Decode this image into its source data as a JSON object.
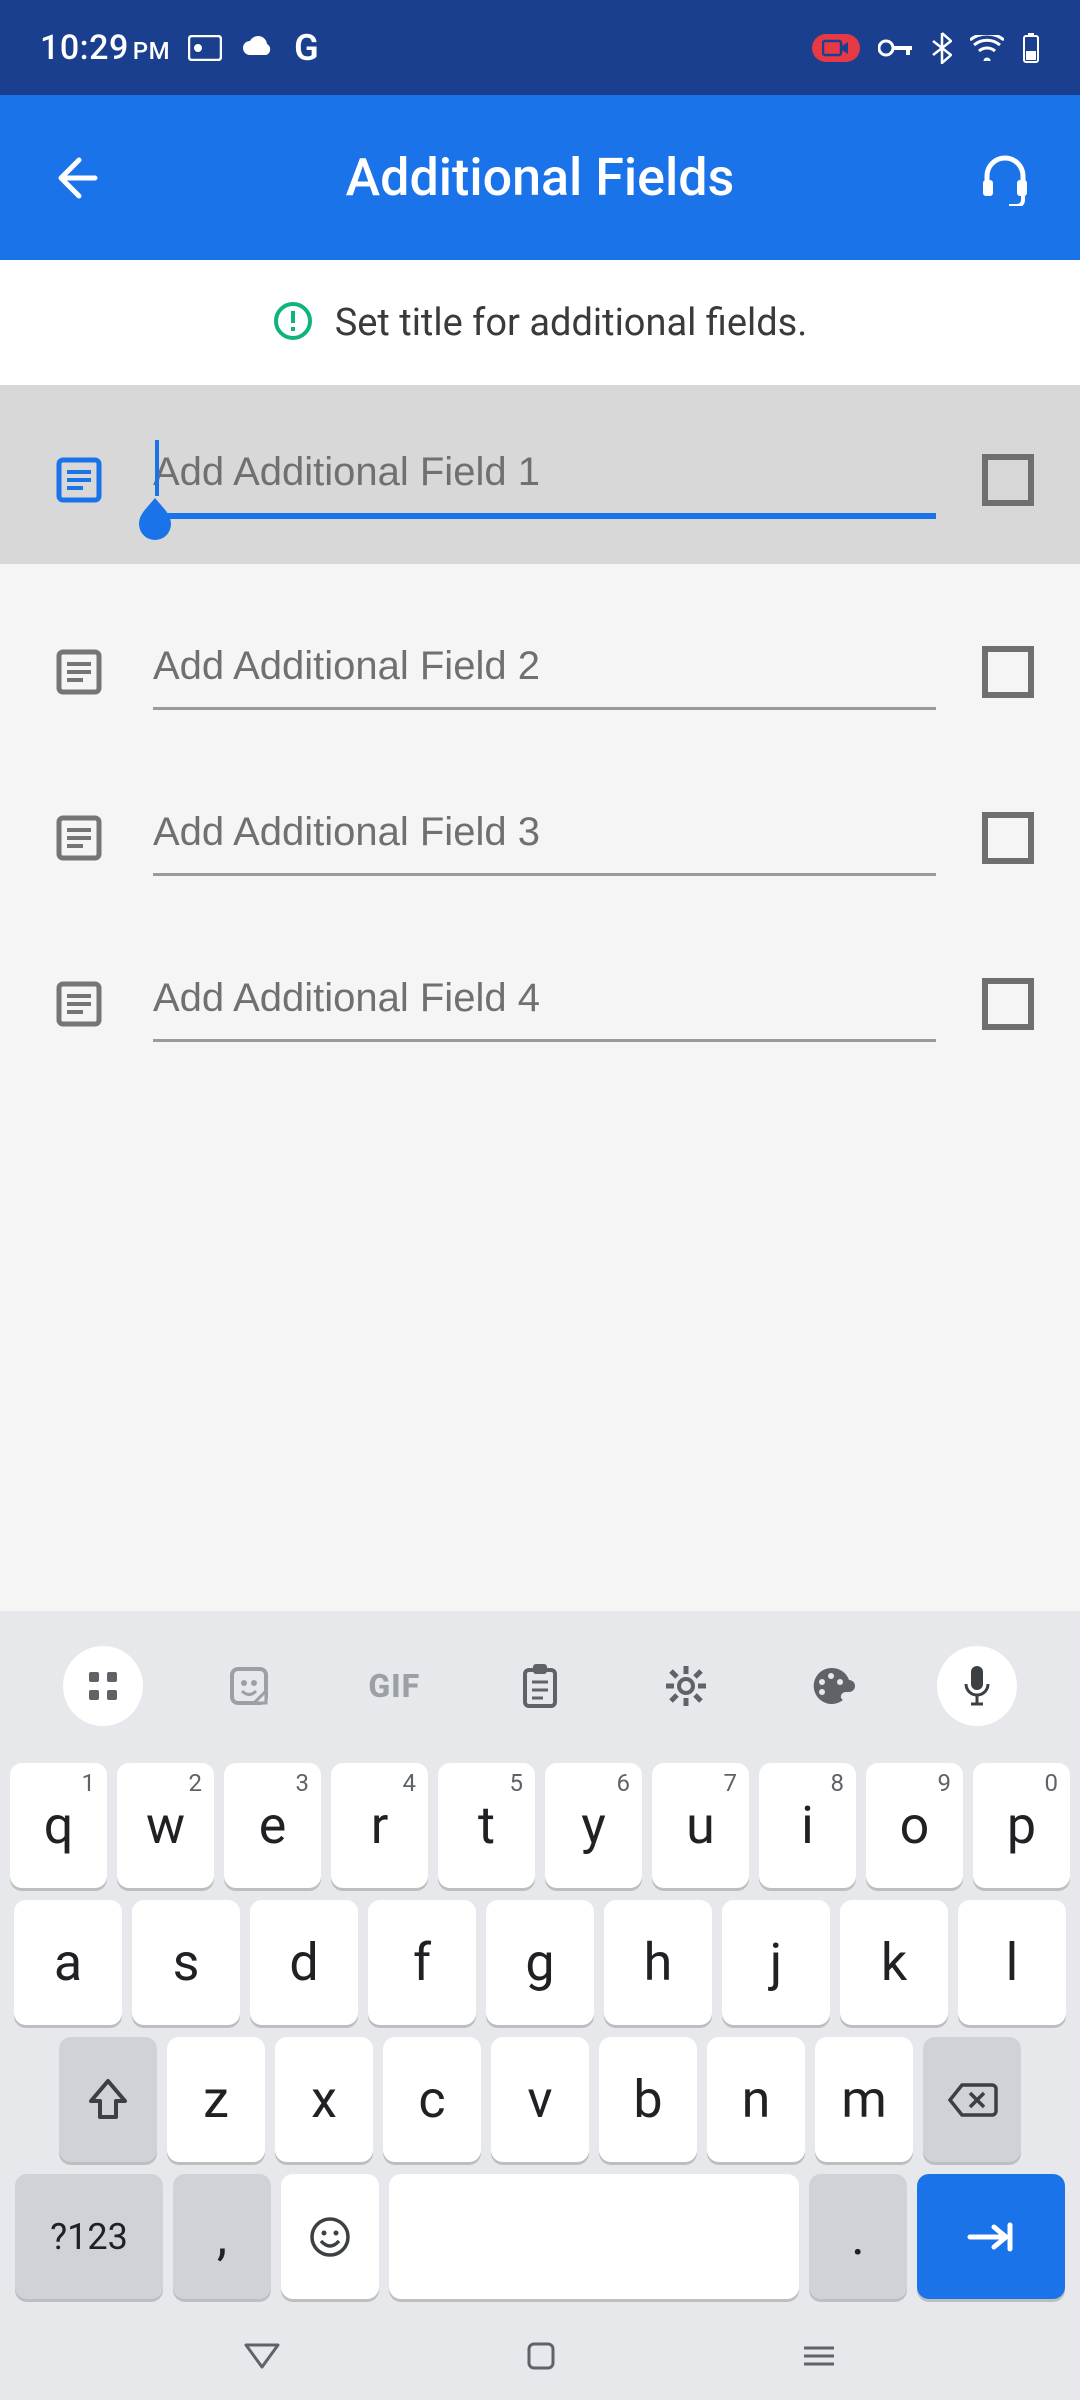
{
  "status": {
    "time": "10:29",
    "ampm": "PM",
    "icons_left": [
      "screencast-icon",
      "cloud-icon",
      "google-icon"
    ],
    "icons_right": [
      "rec-icon",
      "vpn-key-icon",
      "bluetooth-icon",
      "wifi-icon",
      "battery-icon"
    ],
    "google_glyph": "G"
  },
  "appbar": {
    "title": "Additional Fields"
  },
  "info": {
    "text": "Set title for additional fields."
  },
  "fields": [
    {
      "placeholder": "Add Additional Field 1",
      "value": "",
      "active": true,
      "checked": false
    },
    {
      "placeholder": "Add Additional Field 2",
      "value": "",
      "active": false,
      "checked": false
    },
    {
      "placeholder": "Add Additional Field 3",
      "value": "",
      "active": false,
      "checked": false
    },
    {
      "placeholder": "Add Additional Field 4",
      "value": "",
      "active": false,
      "checked": false
    }
  ],
  "keyboard": {
    "toolbar": [
      "apps-icon",
      "sticker-icon",
      "GIF",
      "clipboard-icon",
      "settings-icon",
      "palette-icon",
      "mic-icon"
    ],
    "row1": [
      {
        "k": "q",
        "s": "1"
      },
      {
        "k": "w",
        "s": "2"
      },
      {
        "k": "e",
        "s": "3"
      },
      {
        "k": "r",
        "s": "4"
      },
      {
        "k": "t",
        "s": "5"
      },
      {
        "k": "y",
        "s": "6"
      },
      {
        "k": "u",
        "s": "7"
      },
      {
        "k": "i",
        "s": "8"
      },
      {
        "k": "o",
        "s": "9"
      },
      {
        "k": "p",
        "s": "0"
      }
    ],
    "row2": [
      "a",
      "s",
      "d",
      "f",
      "g",
      "h",
      "j",
      "k",
      "l"
    ],
    "row3": [
      "z",
      "x",
      "c",
      "v",
      "b",
      "n",
      "m"
    ],
    "fn_label": "?123",
    "comma": ",",
    "period": "."
  }
}
